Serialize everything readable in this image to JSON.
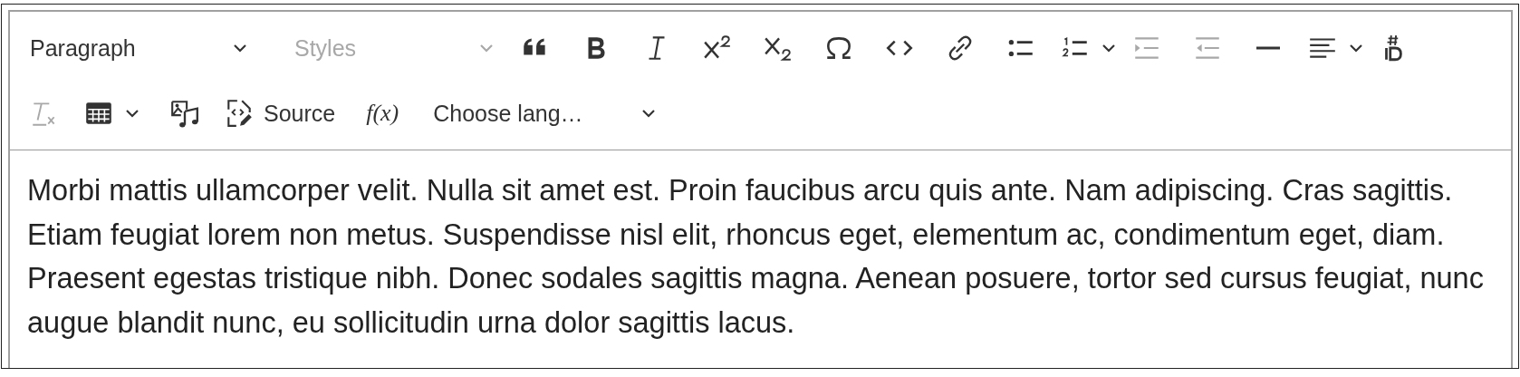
{
  "toolbar": {
    "rows": [
      [
        {
          "kind": "dropdown",
          "label": "Paragraph",
          "disabled": false
        },
        {
          "kind": "dropdown",
          "label": "Styles",
          "disabled": true
        },
        {
          "kind": "button",
          "disabled": false
        },
        {
          "kind": "button",
          "disabled": false
        },
        {
          "kind": "button",
          "disabled": false
        },
        {
          "kind": "button",
          "disabled": false
        },
        {
          "kind": "button",
          "disabled": false
        },
        {
          "kind": "button",
          "disabled": false
        },
        {
          "kind": "button",
          "disabled": false
        },
        {
          "kind": "button",
          "disabled": false
        },
        {
          "kind": "button",
          "disabled": false
        },
        {
          "kind": "split",
          "disabled": false
        },
        {
          "kind": "button",
          "disabled": true
        },
        {
          "kind": "button",
          "disabled": true
        },
        {
          "kind": "button",
          "disabled": false
        },
        {
          "kind": "split",
          "disabled": false
        },
        {
          "kind": "button",
          "disabled": false
        }
      ],
      [
        {
          "kind": "button",
          "disabled": true
        },
        {
          "kind": "split",
          "disabled": false
        },
        {
          "kind": "button",
          "disabled": false
        },
        {
          "kind": "button",
          "label": "Source",
          "disabled": false
        },
        {
          "kind": "glyph",
          "label": "f(x)",
          "disabled": false
        },
        {
          "kind": "dropdown",
          "label": "Choose lang…",
          "disabled": false
        }
      ]
    ]
  },
  "content": {
    "paragraph": "Morbi mattis ullamcorper velit. Nulla sit amet est. Proin faucibus arcu quis ante. Nam adipiscing. Cras sagittis. Etiam feugiat lorem non metus. Suspendisse nisl elit, rhoncus eget, elementum ac, condimentum eget, diam. Praesent egestas tristique nibh. Donec sodales sagittis magna. Aenean posuere, tortor sed cursus feugiat, nunc augue blandit nunc, eu sollicitudin urna dolor sagittis lacus."
  }
}
